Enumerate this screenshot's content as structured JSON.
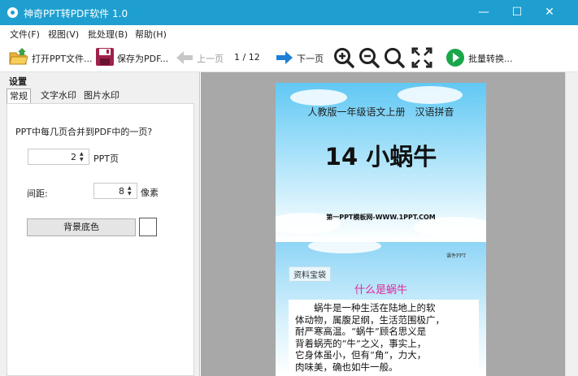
{
  "window": {
    "title": "神奇PPT转PDF软件 1.0",
    "minimize": "—",
    "maximize": "☐",
    "close": "✕"
  },
  "menu": {
    "items": [
      {
        "label": "文件(F)"
      },
      {
        "label": "视图(V)"
      },
      {
        "label": "批处理(B)"
      },
      {
        "label": "帮助(H)"
      }
    ]
  },
  "toolbar": {
    "open_label": "打开PPT文件...",
    "save_label": "保存为PDF...",
    "prev_label": "上一页",
    "page_indicator": "1 / 12",
    "next_label": "下一页",
    "batch_label": "批量转换..."
  },
  "settings": {
    "title": "设置",
    "tabs": [
      {
        "label": "常规"
      },
      {
        "label": "文字水印"
      },
      {
        "label": "图片水印"
      }
    ],
    "question": "PPT中每几页合并到PDF中的一页?",
    "pages_per_sheet": "2",
    "pages_unit": "PPT页",
    "spacing_label": "间距:",
    "spacing_value": "8",
    "spacing_unit": "像素",
    "bg_button": "背景底色"
  },
  "preview": {
    "slide1": {
      "subtitle": "人教版一年级语文上册　汉语拼音",
      "title": "14 小蜗牛",
      "footer": "第一PPT模板网-WWW.1PPT.COM"
    },
    "slide2": {
      "corner_tag": "课件PPT",
      "section_tag": "资料宝袋",
      "heading": "什么是蜗牛",
      "paragraph_lines": [
        "蜗牛是一种生活在陆地上的软",
        "体动物，属腹足纲，生活范围极广，",
        "耐严寒高温。“蜗牛”顾名思义是",
        "背着蜗壳的“牛”之义，事实上，",
        "它身体虽小，但有“角”，力大，",
        "肉味美，确也如牛一般。"
      ]
    }
  },
  "colors": {
    "titlebar": "#1e9fd0",
    "heading_magenta": "#e2289b",
    "arrow_blue": "#1e7fd6",
    "batch_green": "#1aa64a"
  }
}
